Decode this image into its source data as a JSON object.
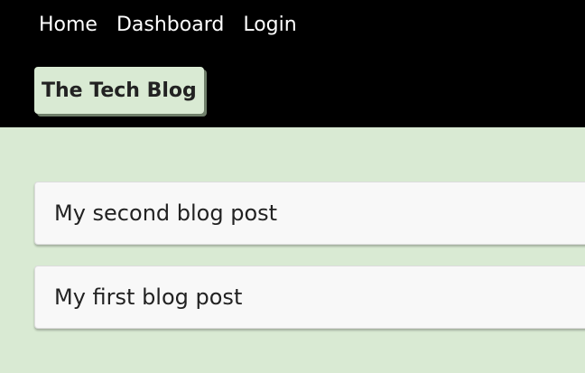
{
  "nav": {
    "items": [
      {
        "label": "Home"
      },
      {
        "label": "Dashboard"
      },
      {
        "label": "Login"
      }
    ]
  },
  "brand": {
    "title": "The Tech Blog"
  },
  "posts": [
    {
      "title": "My second blog post"
    },
    {
      "title": "My first blog post"
    }
  ],
  "colors": {
    "header_bg": "#000000",
    "page_bg": "#d9ead3",
    "card_bg": "#f8f8f8"
  }
}
